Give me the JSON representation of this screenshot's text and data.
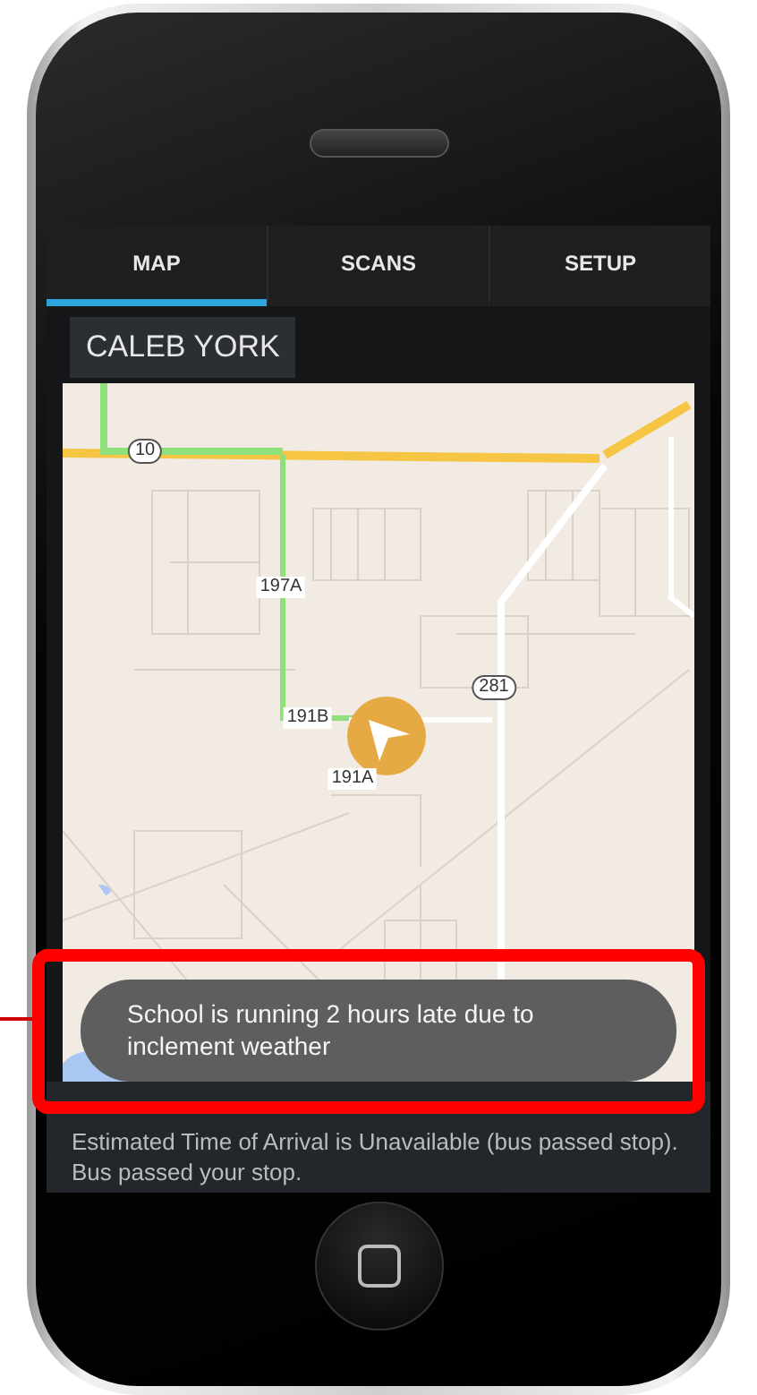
{
  "tabs": [
    {
      "label": "MAP",
      "selected": true
    },
    {
      "label": "SCANS",
      "selected": false
    },
    {
      "label": "SETUP",
      "selected": false
    }
  ],
  "student": {
    "name": "CALEB YORK"
  },
  "map": {
    "labels": [
      {
        "text": "10",
        "kind": "shield"
      },
      {
        "text": "197A",
        "kind": "stop"
      },
      {
        "text": "191B",
        "kind": "stop"
      },
      {
        "text": "191A",
        "kind": "stop"
      },
      {
        "text": "281",
        "kind": "shield"
      }
    ]
  },
  "toast": {
    "message": "School is running 2 hours late due to inclement weather"
  },
  "eta": {
    "message": "Estimated Time of Arrival is Unavailable (bus passed stop). Bus passed your stop."
  }
}
